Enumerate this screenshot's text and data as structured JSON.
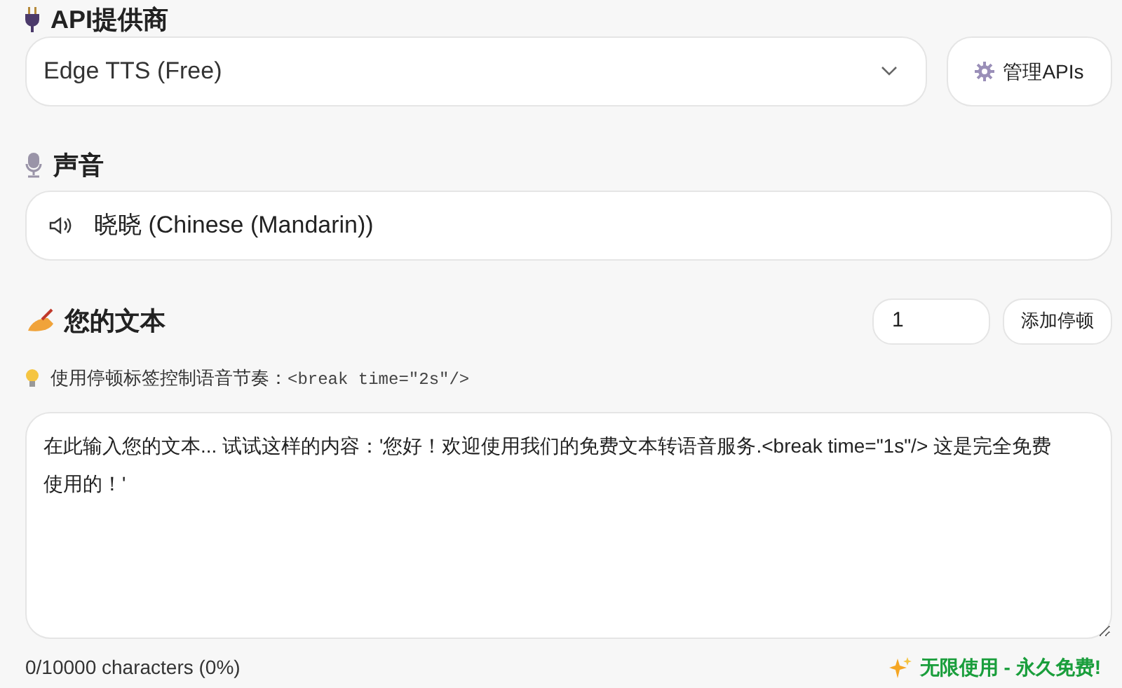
{
  "provider": {
    "heading": "API提供商",
    "value": "Edge TTS (Free)",
    "manage_button": "管理APIs"
  },
  "voice": {
    "heading": "声音",
    "value": "晓晓 (Chinese (Mandarin))"
  },
  "text": {
    "heading": "您的文本",
    "pause_value": "1",
    "add_pause_button": "添加停顿",
    "hint": "使用停顿标签控制语音节奏：",
    "hint_code": "<break time=\"2s\"/>",
    "placeholder": "在此输入您的文本... 试试这样的内容：'您好！欢迎使用我们的免费文本转语音服务.<break time=\"1s\"/> 这是完全免费使用的！'"
  },
  "footer": {
    "count": "0/10000 characters (0%)",
    "badge": "无限使用 - 永久免费!"
  }
}
